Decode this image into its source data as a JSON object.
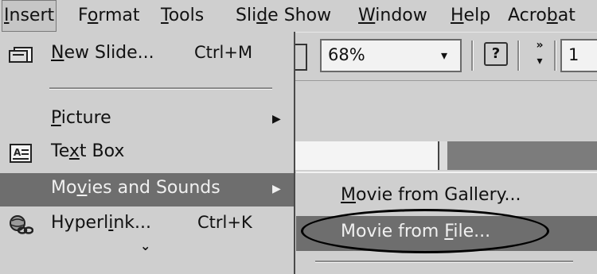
{
  "menubar": {
    "items": [
      {
        "pre": "",
        "key": "I",
        "post": "nsert"
      },
      {
        "pre": "F",
        "key": "o",
        "post": "rmat"
      },
      {
        "pre": "",
        "key": "T",
        "post": "ools"
      },
      {
        "pre": "Sli",
        "key": "d",
        "post": "e Show"
      },
      {
        "pre": "",
        "key": "W",
        "post": "indow"
      },
      {
        "pre": "",
        "key": "H",
        "post": "elp"
      },
      {
        "pre": "Acro",
        "key": "b",
        "post": "at"
      }
    ]
  },
  "toolbar": {
    "zoom_value": "68%",
    "font_size_partial": "1",
    "help_glyph": "?",
    "more_glyph": "»",
    "dropdown_glyph": "▾"
  },
  "insert_menu": {
    "items": [
      {
        "pre": "",
        "key": "N",
        "post": "ew Slide...",
        "shortcut": "Ctrl+M",
        "icon": "new-slide-icon"
      },
      {
        "pre": "",
        "key": "P",
        "post": "icture",
        "has_submenu": true
      },
      {
        "pre": "Te",
        "key": "x",
        "post": "t Box",
        "icon": "text-box-icon"
      },
      {
        "pre": "Mo",
        "key": "v",
        "post": "ies and Sounds",
        "has_submenu": true,
        "highlighted": true
      },
      {
        "pre": "Hyperl",
        "key": "i",
        "post": "nk...",
        "shortcut": "Ctrl+K",
        "icon": "hyperlink-icon"
      }
    ],
    "expand_glyph": "⌄",
    "submenu_arrow": "▶"
  },
  "movies_submenu": {
    "items": [
      {
        "pre": "",
        "key": "M",
        "post": "ovie from Gallery..."
      },
      {
        "pre": "Movie from ",
        "key": "F",
        "post": "ile...",
        "highlighted": true,
        "circled": true
      }
    ]
  },
  "colors": {
    "menu_bg": "#cfcfcf",
    "highlight_bg": "#6e6e6e",
    "highlight_text": "#f0f0f0"
  }
}
